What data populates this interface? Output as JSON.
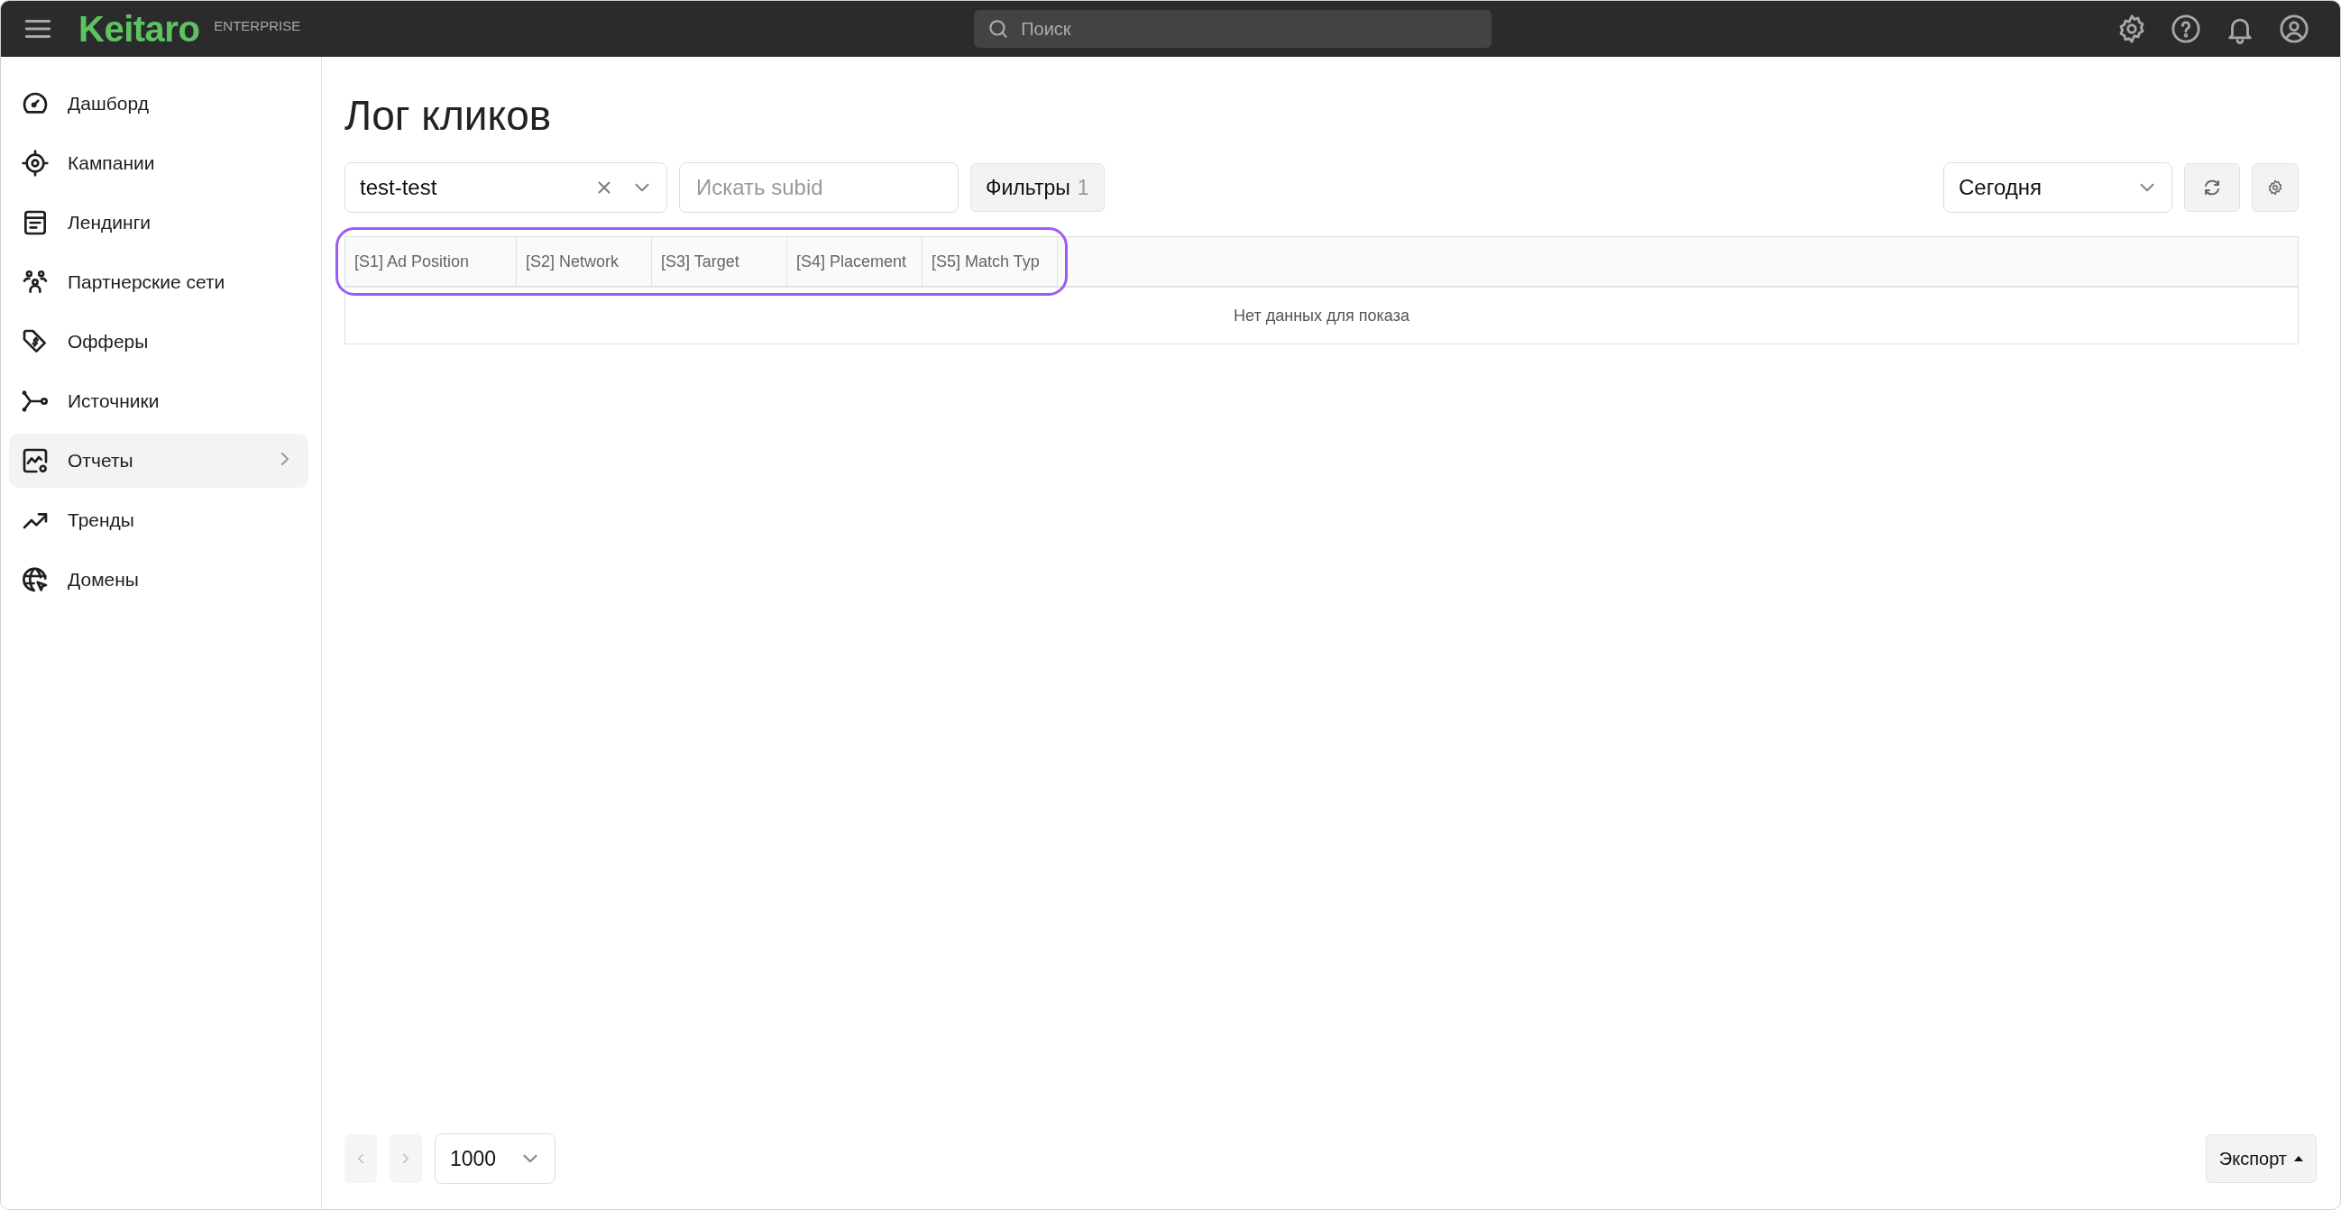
{
  "topbar": {
    "logo": "Keitaro",
    "edition": "ENTERPRISE",
    "search": {
      "placeholder": "Поиск"
    }
  },
  "sidebar": {
    "items": [
      {
        "label": "Дашборд",
        "selected": false,
        "has_submenu": false
      },
      {
        "label": "Кампании",
        "selected": false,
        "has_submenu": false
      },
      {
        "label": "Лендинги",
        "selected": false,
        "has_submenu": false
      },
      {
        "label": "Партнерские сети",
        "selected": false,
        "has_submenu": false
      },
      {
        "label": "Офферы",
        "selected": false,
        "has_submenu": false
      },
      {
        "label": "Источники",
        "selected": false,
        "has_submenu": false
      },
      {
        "label": "Отчеты",
        "selected": true,
        "has_submenu": true
      },
      {
        "label": "Тренды",
        "selected": false,
        "has_submenu": false
      },
      {
        "label": "Домены",
        "selected": false,
        "has_submenu": false
      }
    ]
  },
  "page": {
    "title": "Лог кликов",
    "campaign_select": {
      "value": "test-test"
    },
    "subid_search": {
      "placeholder": "Искать subid"
    },
    "filters_button": {
      "label": "Фильтры",
      "count": "1"
    },
    "period_select": {
      "value": "Сегодня"
    },
    "table": {
      "highlighted": true,
      "columns": [
        "[S1] Ad Position",
        "[S2] Network",
        "[S3] Target",
        "[S4] Placement",
        "[S5] Match Typ"
      ],
      "empty_text": "Нет данных для показа"
    },
    "pagination": {
      "prev": {
        "disabled": true
      },
      "next": {
        "disabled": true
      },
      "page_size": "1000"
    },
    "export_button": {
      "label": "Экспорт"
    }
  }
}
